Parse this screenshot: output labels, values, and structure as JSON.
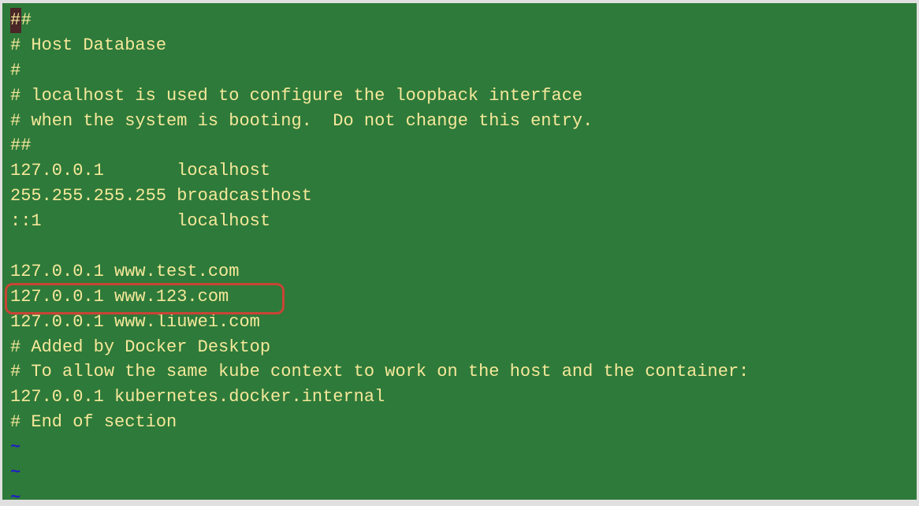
{
  "editor": {
    "lines": [
      {
        "text": "##",
        "cursor_at_start": true,
        "tilde": false
      },
      {
        "text": "# Host Database",
        "cursor_at_start": false,
        "tilde": false
      },
      {
        "text": "#",
        "cursor_at_start": false,
        "tilde": false
      },
      {
        "text": "# localhost is used to configure the loopback interface",
        "cursor_at_start": false,
        "tilde": false
      },
      {
        "text": "# when the system is booting.  Do not change this entry.",
        "cursor_at_start": false,
        "tilde": false
      },
      {
        "text": "##",
        "cursor_at_start": false,
        "tilde": false
      },
      {
        "text": "127.0.0.1       localhost",
        "cursor_at_start": false,
        "tilde": false
      },
      {
        "text": "255.255.255.255 broadcasthost",
        "cursor_at_start": false,
        "tilde": false
      },
      {
        "text": "::1             localhost",
        "cursor_at_start": false,
        "tilde": false
      },
      {
        "text": "",
        "cursor_at_start": false,
        "tilde": false
      },
      {
        "text": "127.0.0.1 www.test.com",
        "cursor_at_start": false,
        "tilde": false
      },
      {
        "text": "127.0.0.1 www.123.com",
        "cursor_at_start": false,
        "tilde": false
      },
      {
        "text": "127.0.0.1 www.liuwei.com",
        "cursor_at_start": false,
        "tilde": false
      },
      {
        "text": "# Added by Docker Desktop",
        "cursor_at_start": false,
        "tilde": false
      },
      {
        "text": "# To allow the same kube context to work on the host and the container:",
        "cursor_at_start": false,
        "tilde": false
      },
      {
        "text": "127.0.0.1 kubernetes.docker.internal",
        "cursor_at_start": false,
        "tilde": false
      },
      {
        "text": "# End of section",
        "cursor_at_start": false,
        "tilde": false
      },
      {
        "text": "~",
        "cursor_at_start": false,
        "tilde": true
      },
      {
        "text": "~",
        "cursor_at_start": false,
        "tilde": true
      },
      {
        "text": "~",
        "cursor_at_start": false,
        "tilde": true
      }
    ],
    "callout_highlighted_line_index": 11
  }
}
